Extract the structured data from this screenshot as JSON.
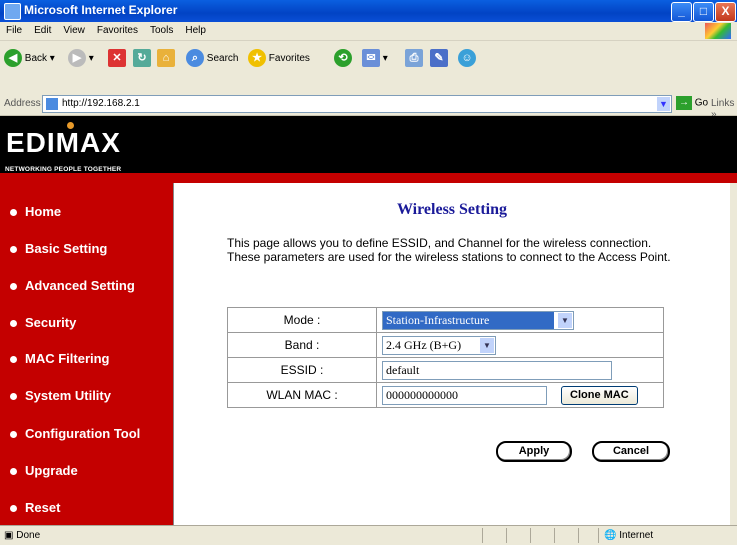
{
  "window": {
    "title": "Microsoft Internet Explorer",
    "min": "_",
    "max": "□",
    "close": "X"
  },
  "menu": [
    "File",
    "Edit",
    "View",
    "Favorites",
    "Tools",
    "Help"
  ],
  "toolbar": {
    "back": "Back",
    "search": "Search",
    "favorites": "Favorites"
  },
  "address": {
    "label": "Address",
    "url": "http://192.168.2.1",
    "go": "Go",
    "links": "Links"
  },
  "brand": {
    "logo": "EDIMAX",
    "tagline": "NETWORKING PEOPLE TOGETHER"
  },
  "sidebar": {
    "items": [
      {
        "label": "Home"
      },
      {
        "label": "Basic Setting"
      },
      {
        "label": "Advanced Setting"
      },
      {
        "label": "Security"
      },
      {
        "label": "MAC Filtering"
      },
      {
        "label": "System Utility"
      },
      {
        "label": "Configuration Tool"
      },
      {
        "label": "Upgrade"
      },
      {
        "label": "Reset"
      }
    ]
  },
  "main": {
    "title": "Wireless Setting",
    "description": "This page allows you to define ESSID, and Channel for the wireless connection. These parameters are used for the wireless stations to connect to the Access Point.",
    "form": {
      "mode_label": "Mode :",
      "mode_value": "Station-Infrastructure",
      "band_label": "Band :",
      "band_value": "2.4 GHz (B+G)",
      "essid_label": "ESSID :",
      "essid_value": "default",
      "wlanmac_label": "WLAN MAC :",
      "wlanmac_value": "000000000000",
      "clone_mac": "Clone MAC"
    },
    "apply": "Apply",
    "cancel": "Cancel"
  },
  "status": {
    "text": "Done",
    "zone": "Internet"
  },
  "colors": {
    "sidebar_bg": "#c40000",
    "title_color": "#1a1a99",
    "xp_title": "#0a5fe0"
  }
}
